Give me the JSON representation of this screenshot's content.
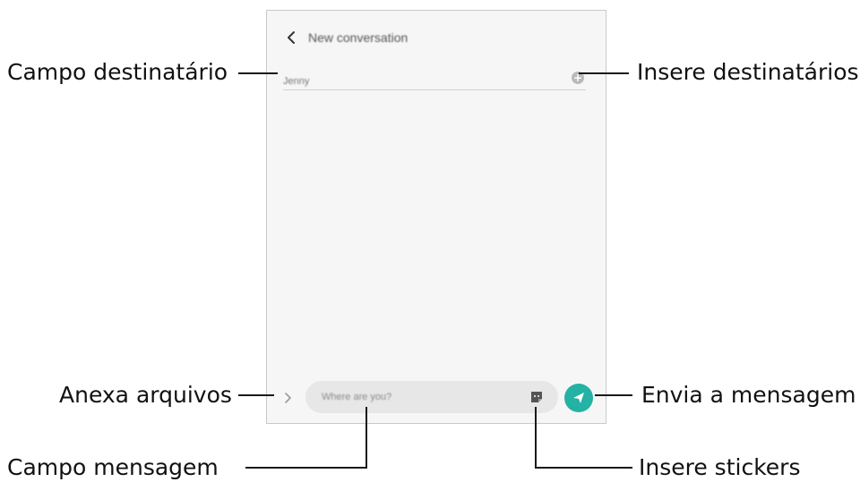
{
  "screen": {
    "header": {
      "title": "New conversation",
      "back_icon": "chevron-left-icon"
    },
    "recipient": {
      "value": "Jenny",
      "add_icon": "plus-circle-icon"
    },
    "composer": {
      "attach_icon": "chevron-right-icon",
      "placeholder": "Where are you?",
      "sticker_icon": "sticker-icon",
      "send_icon": "send-icon"
    },
    "colors": {
      "send_button": "#23b2a3",
      "screen_background": "#f6f6f6"
    }
  },
  "annotations": {
    "recipient_field": "Campo destinatário",
    "add_recipients": "Insere destinatários",
    "attach_files": "Anexa arquivos",
    "send_message": "Envia a mensagem",
    "message_field": "Campo mensagem",
    "insert_stickers": "Insere stickers"
  }
}
